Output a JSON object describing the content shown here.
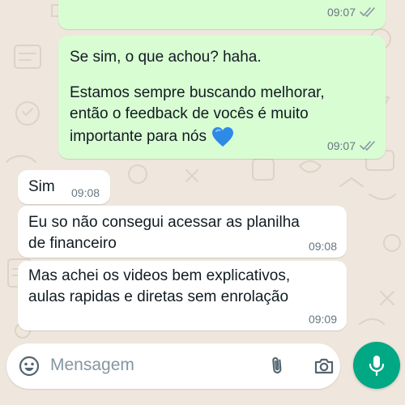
{
  "theme": {
    "wallpaper": "#efe7dd",
    "outgoing_bubble": "#d9fdd3",
    "incoming_bubble": "#ffffff",
    "accent": "#00a884",
    "meta_text": "#667781",
    "read_ticks": "#8696a0"
  },
  "chat": {
    "top_partial_message": {
      "time": "09:07",
      "status": "read"
    },
    "messages": [
      {
        "direction": "outgoing",
        "lines": [
          "Se sim, o que achou? haha.",
          "",
          "Estamos sempre buscando melhorar,",
          "então o feedback de vocês é muito",
          "importante para nós"
        ],
        "emoji": "blue-heart",
        "time": "09:07",
        "status": "read"
      },
      {
        "direction": "incoming",
        "lines": [
          "Sim"
        ],
        "time": "09:08"
      },
      {
        "direction": "incoming",
        "lines": [
          "Eu so não consegui acessar as planilha",
          "de financeiro"
        ],
        "time": "09:08"
      },
      {
        "direction": "incoming",
        "lines": [
          "Mas achei os videos bem explicativos,",
          "aulas rapidas e diretas sem enrolação"
        ],
        "time": "09:09"
      }
    ]
  },
  "composer": {
    "placeholder": "Mensagem",
    "emoji_icon": "emoji-smiley-icon",
    "attach_icon": "paperclip-icon",
    "camera_icon": "camera-icon",
    "mic_icon": "microphone-icon"
  }
}
